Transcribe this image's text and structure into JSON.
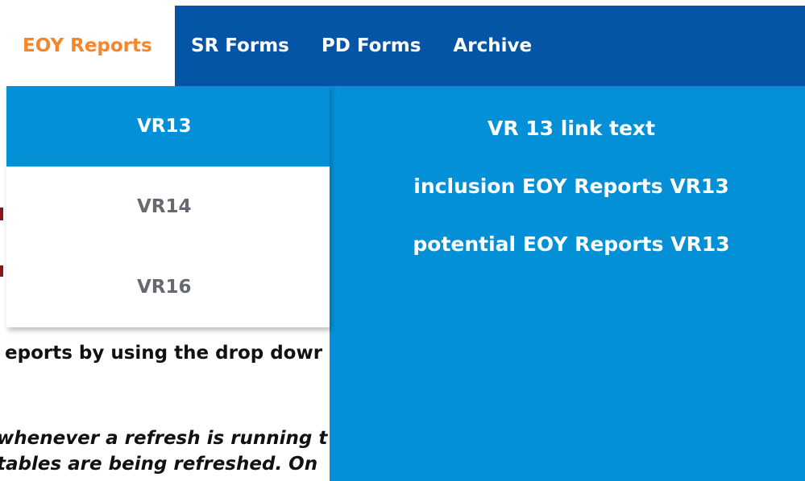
{
  "nav": {
    "tabs": [
      {
        "label": "EOY Reports"
      },
      {
        "label": "SR Forms"
      },
      {
        "label": "PD Forms"
      },
      {
        "label": "Archive"
      }
    ]
  },
  "submenu": {
    "items": [
      {
        "label": "VR13"
      },
      {
        "label": "VR14"
      },
      {
        "label": "VR16"
      }
    ]
  },
  "links": [
    {
      "label": "VR 13 link text"
    },
    {
      "label": "inclusion EOY Reports VR13"
    },
    {
      "label": "potential EOY Reports VR13"
    }
  ],
  "page": {
    "line1": "eports by using the drop dowr",
    "line2": "whenever a refresh is running t",
    "line3": "tables are being refreshed. On"
  },
  "colors": {
    "nav_bg": "#0555a6",
    "menu_bg": "#0490d6",
    "active_tab_text": "#f7852a",
    "submenu_text": "#666a70"
  }
}
